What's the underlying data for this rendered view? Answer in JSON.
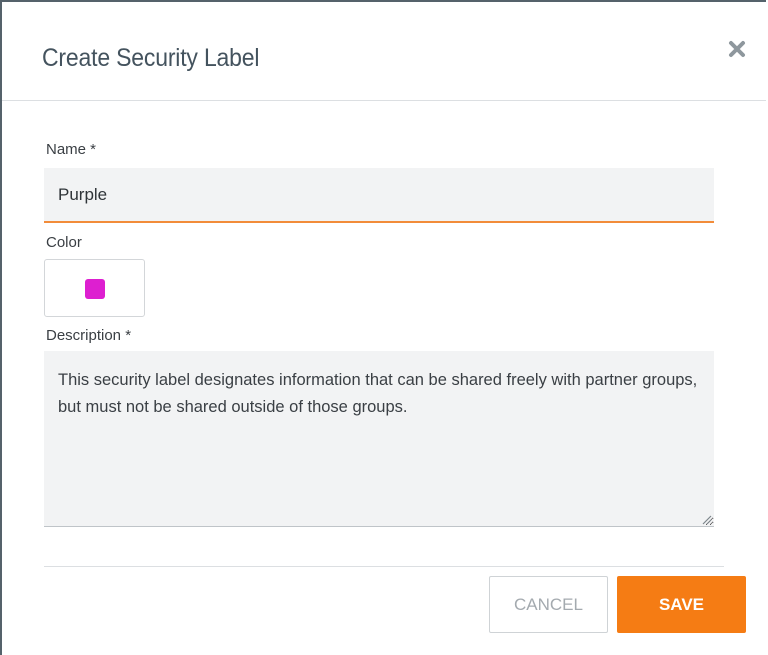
{
  "dialog": {
    "title": "Create Security Label",
    "close_icon": "close-icon"
  },
  "form": {
    "name": {
      "label": "Name *",
      "value": "Purple"
    },
    "color": {
      "label": "Color",
      "value": "#dd1fd0"
    },
    "description": {
      "label": "Description *",
      "value": "This security label designates information that can be shared freely with partner groups, but must not be shared outside of those groups."
    }
  },
  "actions": {
    "cancel_label": "CANCEL",
    "save_label": "SAVE"
  },
  "colors": {
    "accent": "#f57c14",
    "title_text": "#44535e",
    "field_bg": "#f2f3f4"
  }
}
